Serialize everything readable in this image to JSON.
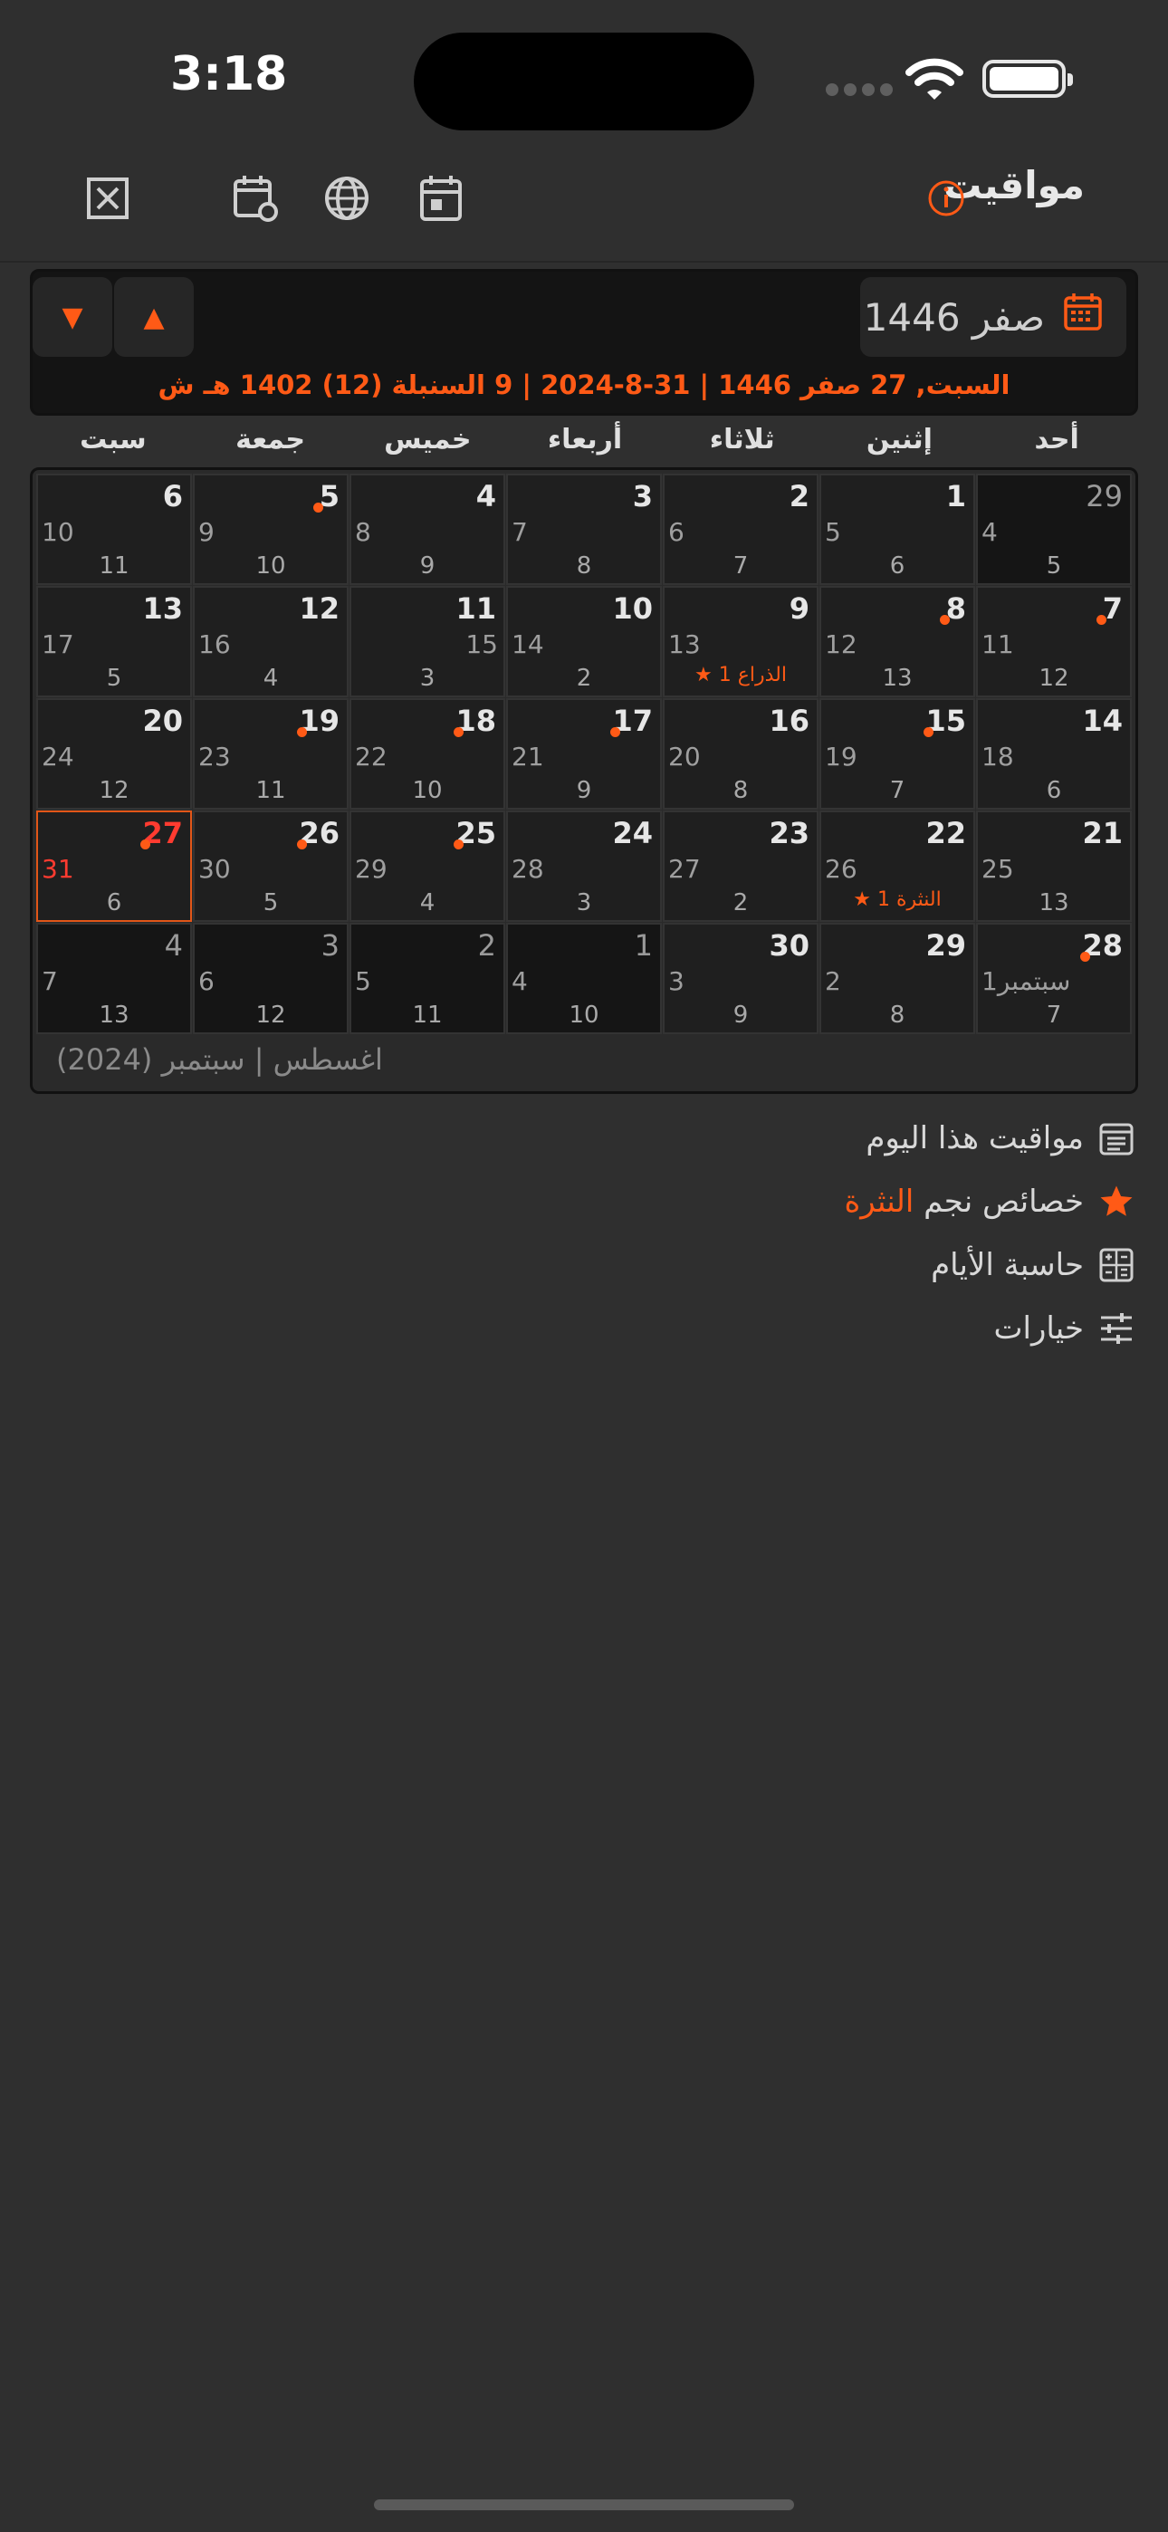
{
  "status": {
    "time": "3:18"
  },
  "nav": {
    "title": "مواقيت"
  },
  "header": {
    "month_label": "صفر 1446",
    "date_line": "السبت, 27 صفر 1446 | 31-8-2024 | 9 السنبلة (12) 1402 هـ ش",
    "up_label": "▲",
    "down_label": "▼"
  },
  "weekdays": [
    "أحد",
    "إثنين",
    "ثلاثاء",
    "أربعاء",
    "خميس",
    "جمعة",
    "سبت"
  ],
  "footer": "اغسطس | سبتمبر (2024)",
  "weeks": [
    [
      {
        "h": "29",
        "g": "4",
        "s": "5",
        "dim": true
      },
      {
        "h": "1",
        "g": "5",
        "s": "6"
      },
      {
        "h": "2",
        "g": "6",
        "s": "7"
      },
      {
        "h": "3",
        "g": "7",
        "s": "8"
      },
      {
        "h": "4",
        "g": "8",
        "s": "9"
      },
      {
        "h": "5",
        "g": "9",
        "s": "10",
        "dot": true
      },
      {
        "h": "6",
        "g": "10",
        "s": "11"
      }
    ],
    [
      {
        "h": "7",
        "g": "11",
        "s": "12",
        "dot": true
      },
      {
        "h": "8",
        "g": "12",
        "s": "13",
        "dot": true
      },
      {
        "h": "9",
        "g": "13",
        "s": "",
        "star": "الذراع 1"
      },
      {
        "h": "10",
        "g": "14",
        "s": "2"
      },
      {
        "h": "11",
        "g": "15",
        "s": "3",
        "gRight": true
      },
      {
        "h": "12",
        "g": "16",
        "s": "4"
      },
      {
        "h": "13",
        "g": "17",
        "s": "5"
      }
    ],
    [
      {
        "h": "14",
        "g": "18",
        "s": "6"
      },
      {
        "h": "15",
        "g": "19",
        "s": "7",
        "dot": true
      },
      {
        "h": "16",
        "g": "20",
        "s": "8"
      },
      {
        "h": "17",
        "g": "21",
        "s": "9",
        "dot": true
      },
      {
        "h": "18",
        "g": "22",
        "s": "10",
        "dot": true
      },
      {
        "h": "19",
        "g": "23",
        "s": "11",
        "dot": true
      },
      {
        "h": "20",
        "g": "24",
        "s": "12"
      }
    ],
    [
      {
        "h": "21",
        "g": "25",
        "s": "13"
      },
      {
        "h": "22",
        "g": "26",
        "s": "",
        "star": "النثرة 1"
      },
      {
        "h": "23",
        "g": "27",
        "s": "2"
      },
      {
        "h": "24",
        "g": "28",
        "s": "3"
      },
      {
        "h": "25",
        "g": "29",
        "s": "4",
        "dot": true
      },
      {
        "h": "26",
        "g": "30",
        "s": "5",
        "dot": true
      },
      {
        "h": "27",
        "g": "31",
        "s": "6",
        "dot": true,
        "today": true
      }
    ],
    [
      {
        "h": "28",
        "g": "1سبتمبر",
        "s": "7",
        "dot": true
      },
      {
        "h": "29",
        "g": "2",
        "s": "8"
      },
      {
        "h": "30",
        "g": "3",
        "s": "9"
      },
      {
        "h": "1",
        "g": "4",
        "s": "10",
        "dim": true
      },
      {
        "h": "2",
        "g": "5",
        "s": "11",
        "dim": true
      },
      {
        "h": "3",
        "g": "6",
        "s": "12",
        "dim": true
      },
      {
        "h": "4",
        "g": "7",
        "s": "13",
        "dim": true
      }
    ]
  ],
  "menu": {
    "times": "مواقيت هذا اليوم",
    "star_prefix": "خصائص نجم",
    "star_name": "النثرة",
    "calculator": "حاسبة الأيام",
    "options": "خيارات"
  },
  "colors": {
    "accent": "#ff5a16",
    "today": "#ff3b30",
    "background": "#2f2f2f"
  }
}
